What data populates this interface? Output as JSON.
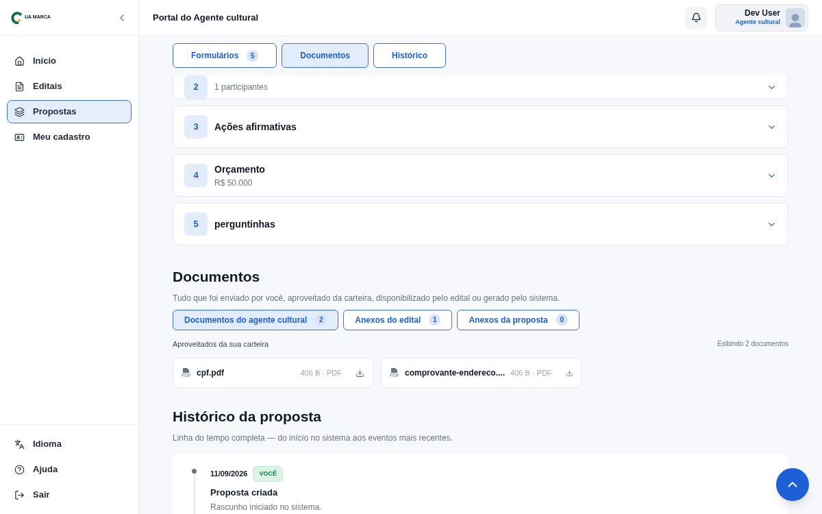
{
  "logo": {
    "text": "UA MARCA"
  },
  "sidebar": {
    "items": [
      {
        "label": "Início",
        "selected": false
      },
      {
        "label": "Editais",
        "selected": false
      },
      {
        "label": "Propostas",
        "selected": true
      },
      {
        "label": "Meu cadastro",
        "selected": false
      }
    ],
    "bottom_items": [
      {
        "label": "Idioma"
      },
      {
        "label": "Ajuda"
      },
      {
        "label": "Sair"
      }
    ]
  },
  "header": {
    "title": "Portal do Agente cultural",
    "user": {
      "name": "Dev User",
      "role": "Agente cultural"
    }
  },
  "tabs": [
    {
      "label": "Formulários",
      "count": "5",
      "selected": false
    },
    {
      "label": "Documentos",
      "selected": true
    },
    {
      "label": "Histórico",
      "selected": false
    }
  ],
  "sections": [
    {
      "number": "2",
      "subtitle": "1 participantes"
    },
    {
      "number": "3",
      "title": "Ações afirmativas"
    },
    {
      "number": "4",
      "title": "Orçamento",
      "subtitle": "R$ 50.000"
    },
    {
      "number": "5",
      "title": "perguntinhas"
    }
  ],
  "documents": {
    "title": "Documentos",
    "description": "Tudo que foi enviado por você, aproveitado da carteira, disponibilizado pelo edital ou gerado pelo sistema.",
    "tabs": [
      {
        "label": "Documentos do agente cultural",
        "count": "2",
        "selected": true
      },
      {
        "label": "Anexos do edital",
        "count": "1",
        "selected": false
      },
      {
        "label": "Anexos da proposta",
        "count": "0",
        "selected": false
      }
    ],
    "group_label": "Aproveitados da sua carteira",
    "showing": "Exibindo 2 documentos",
    "files": [
      {
        "name": "cpf.pdf",
        "meta": "406 B · PDF",
        "type": "PDF"
      },
      {
        "name": "comprovante-endereco....",
        "meta": "406 B · PDF",
        "type": "PDF"
      }
    ]
  },
  "history": {
    "title": "Histórico da proposta",
    "description": "Linha do tempo completa — do início no sistema aos eventos mais recentes.",
    "events": [
      {
        "date": "11/09/2026",
        "badge": "VOCÊ",
        "title": "Proposta criada",
        "description": "Rascunho iniciado no sistema."
      }
    ]
  }
}
